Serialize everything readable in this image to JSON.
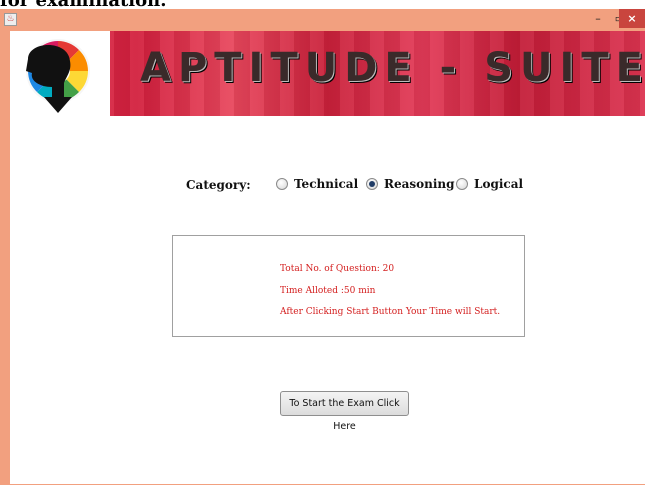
{
  "background_doc": {
    "text": "for examination."
  },
  "window": {
    "icons": {
      "app": "java-app-icon",
      "minimize": "minimize-icon",
      "maximize": "maximize-icon",
      "close": "close-icon"
    },
    "controls": {
      "minimize": "–",
      "maximize": "▭",
      "close": "×"
    }
  },
  "banner": {
    "title": "APTITUDE - SUITE",
    "logo": "head-color-wheel-logo",
    "colors": {
      "banner_red": "#d21f3d",
      "title_dark": "#3a2a2a"
    }
  },
  "category": {
    "label": "Category:",
    "options": [
      {
        "label": "Technical",
        "selected": false
      },
      {
        "label": "Reasoning",
        "selected": true
      },
      {
        "label": "Logical",
        "selected": false
      }
    ]
  },
  "info": {
    "lines": [
      "Total No. of Question: 20",
      "Time Alloted  :50 min",
      "After Clicking Start Button Your Time will  Start."
    ],
    "text_color": "#d42020"
  },
  "start_button": {
    "label": "To Start the Exam Click Here"
  },
  "colors": {
    "frame": "#f2a07f",
    "close_button": "#c9453e",
    "radio_dot": "#1f3c66"
  }
}
